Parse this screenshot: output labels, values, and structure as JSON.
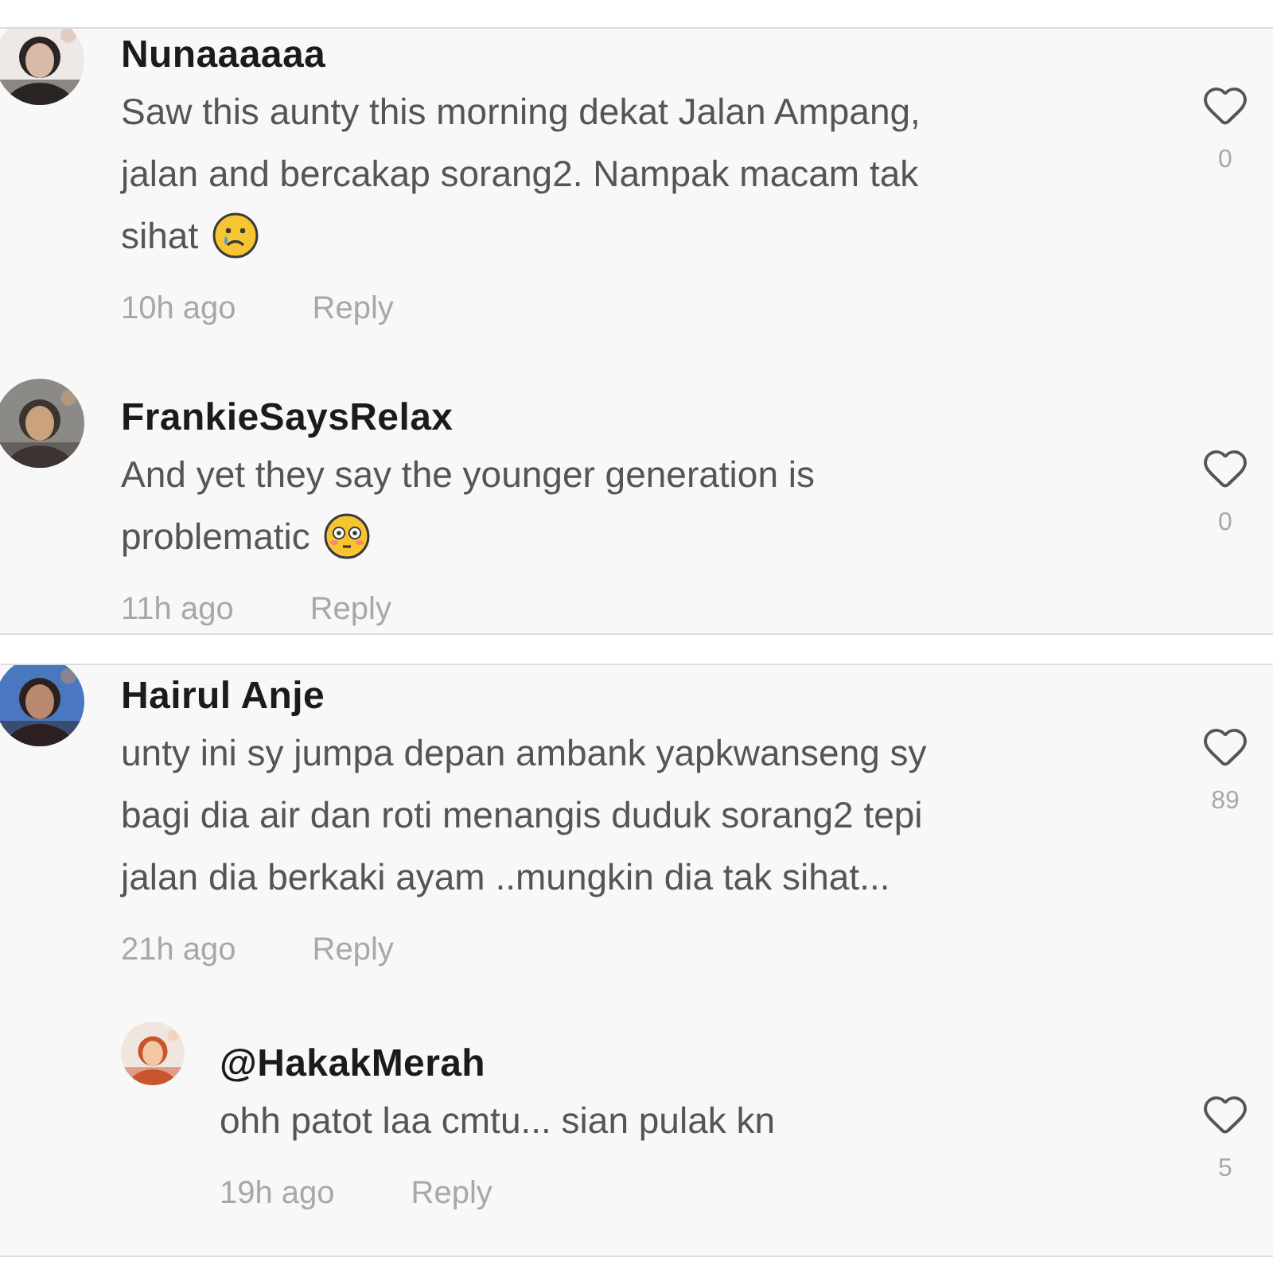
{
  "panels": [
    {
      "comments": [
        {
          "avatar": {
            "kind": "picture"
          },
          "user": "Nunaaaaaa",
          "text": "Saw this aunty this morning dekat Jalan Ampang, jalan and bercakap sorang2. Nampak macam tak sihat",
          "emoji": {
            "kind": "crying"
          },
          "time": "10h ago",
          "reply_label": "Reply",
          "likes": "0",
          "liked": false
        },
        {
          "avatar": {
            "kind": "picture"
          },
          "user": "FrankieSaysRelax",
          "text": "And yet they say the younger generation is problematic",
          "emoji": {
            "kind": "flushed"
          },
          "time": "11h ago",
          "reply_label": "Reply",
          "likes": "0",
          "liked": false
        }
      ]
    },
    {
      "comments": [
        {
          "avatar": {
            "kind": "picture"
          },
          "user": "Hairul Anje",
          "text": "unty ini sy jumpa depan ambank yapkwanseng sy bagi dia air dan roti menangis duduk sorang2 tepi jalan dia berkaki ayam ..mungkin dia tak sihat...",
          "time": "21h ago",
          "reply_label": "Reply",
          "likes": "89",
          "liked": false,
          "replies": [
            {
              "avatar": {
                "kind": "picture"
              },
              "user": "@HakakMerah",
              "text": "ohh patot laa cmtu... sian pulak kn",
              "time": "19h ago",
              "reply_label": "Reply",
              "likes": "5",
              "liked": false
            }
          ]
        }
      ]
    }
  ]
}
